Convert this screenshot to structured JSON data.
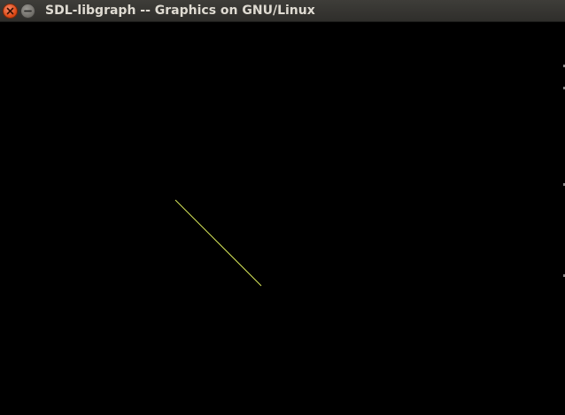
{
  "window": {
    "title": "SDL-libgraph -- Graphics on GNU/Linux"
  },
  "titlebar_buttons": [
    {
      "name": "close",
      "icon": "close-icon",
      "color": "#dd4814"
    },
    {
      "name": "minimize",
      "icon": "minimize-icon",
      "color": "#6e6c67"
    }
  ],
  "canvas": {
    "background": "#000000",
    "line_color": "#d8e85a"
  }
}
